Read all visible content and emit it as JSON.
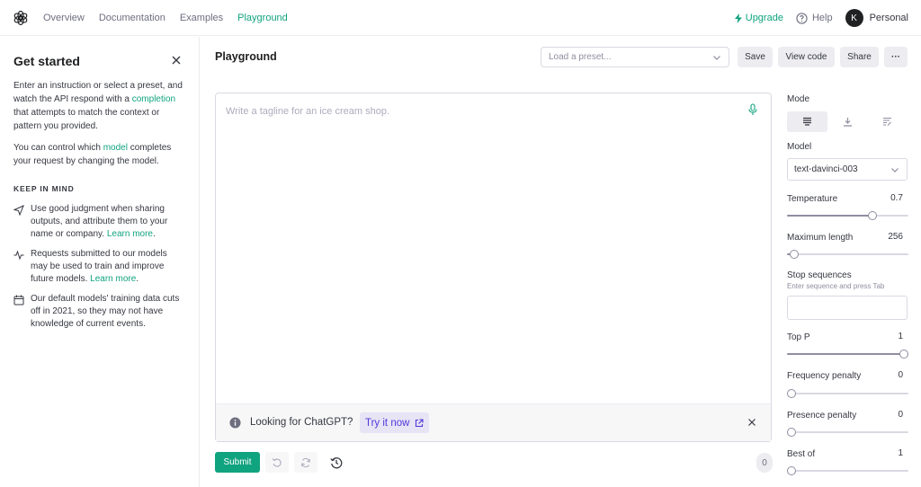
{
  "nav": {
    "links": [
      "Overview",
      "Documentation",
      "Examples",
      "Playground"
    ],
    "upgrade": "Upgrade",
    "help": "Help",
    "avatar_initial": "K",
    "account": "Personal"
  },
  "sidebar": {
    "title": "Get started",
    "intro_1": "Enter an instruction or select a preset, and watch the API respond with a ",
    "intro_link": "completion",
    "intro_2": " that attempts to match the context or pattern you provided.",
    "model_1": "You can control which ",
    "model_link": "model",
    "model_2": " completes your request by changing the model.",
    "keep_in_mind": "KEEP IN MIND",
    "tips": [
      {
        "text": "Use good judgment when sharing outputs, and attribute them to your name or company. ",
        "link": "Learn more",
        "suffix": "."
      },
      {
        "text": "Requests submitted to our models may be used to train and improve future models. ",
        "link": "Learn more",
        "suffix": "."
      },
      {
        "text": "Our default models' training data cuts off in 2021, so they may not have knowledge of current events.",
        "link": "",
        "suffix": ""
      }
    ]
  },
  "main": {
    "title": "Playground",
    "preset_placeholder": "Load a preset...",
    "save": "Save",
    "view_code": "View code",
    "share": "Share",
    "more": "···",
    "prompt_placeholder": "Write a tagline for an ice cream shop.",
    "banner_text": "Looking for ChatGPT?",
    "banner_link": "Try it now",
    "submit": "Submit",
    "token_count": "0"
  },
  "params": {
    "mode_label": "Mode",
    "model_label": "Model",
    "model_value": "text-davinci-003",
    "temperature": {
      "label": "Temperature",
      "value": "0.7",
      "fraction": 0.7
    },
    "max_length": {
      "label": "Maximum length",
      "value": "256",
      "fraction": 0.06
    },
    "stop_sequences": {
      "label": "Stop sequences",
      "hint": "Enter sequence and press Tab"
    },
    "top_p": {
      "label": "Top P",
      "value": "1",
      "fraction": 1.0
    },
    "frequency_penalty": {
      "label": "Frequency penalty",
      "value": "0",
      "fraction": 0
    },
    "presence_penalty": {
      "label": "Presence penalty",
      "value": "0",
      "fraction": 0
    },
    "best_of": {
      "label": "Best of",
      "value": "1",
      "fraction": 0
    }
  },
  "colors": {
    "accent": "#10a37f",
    "try_bg": "#e6e4f5",
    "try_fg": "#5436da"
  }
}
